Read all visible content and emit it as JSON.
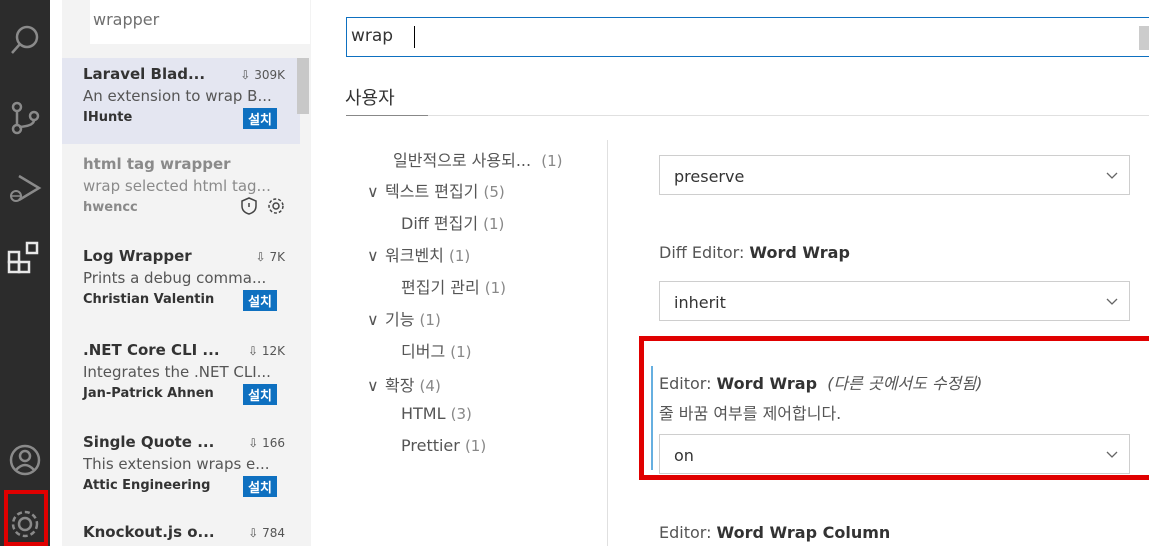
{
  "activity_bar": {
    "icons": [
      "search-icon",
      "source-control-icon",
      "run-debug-icon",
      "extensions-icon",
      "account-icon",
      "manage-gear-icon"
    ]
  },
  "extensions": {
    "search_value": "wrapper",
    "items": [
      {
        "name": "Laravel Blad...",
        "downloads": "309K",
        "description": "An extension to wrap B...",
        "publisher": "IHunte",
        "install_label": "설치"
      },
      {
        "name": "html tag wrapper",
        "downloads": "",
        "description": "wrap selected html tag...",
        "publisher": "hwencc",
        "install_label": ""
      },
      {
        "name": "Log Wrapper",
        "downloads": "7K",
        "description": "Prints a debug comma...",
        "publisher": "Christian Valentin",
        "install_label": "설치"
      },
      {
        "name": ".NET Core CLI ...",
        "downloads": "12K",
        "description": "Integrates the .NET CLI...",
        "publisher": "Jan-Patrick Ahnen",
        "install_label": "설치"
      },
      {
        "name": "Single Quote ...",
        "downloads": "166",
        "description": "This extension wraps e...",
        "publisher": "Attic Engineering",
        "install_label": "설치"
      },
      {
        "name": "Knockout.js o...",
        "downloads": "784",
        "description": "",
        "publisher": "",
        "install_label": ""
      }
    ]
  },
  "settings": {
    "search_value": "wrap",
    "tab_user": "사용자",
    "toc": [
      {
        "label": "일반적으로 사용되...",
        "count": "(1)"
      },
      {
        "label": "텍스트 편집기",
        "count": "(5)"
      },
      {
        "label": "Diff 편집기",
        "count": "(1)"
      },
      {
        "label": "워크벤치",
        "count": "(1)"
      },
      {
        "label": "편집기 관리",
        "count": "(1)"
      },
      {
        "label": "기능",
        "count": "(1)"
      },
      {
        "label": "디버그",
        "count": "(1)"
      },
      {
        "label": "확장",
        "count": "(4)"
      },
      {
        "label": "HTML",
        "count": "(3)"
      },
      {
        "label": "Prettier",
        "count": "(1)"
      }
    ],
    "items": {
      "first_dropdown_value": "preserve",
      "diff_title_prefix": "Diff Editor: ",
      "diff_title_bold": "Word Wrap",
      "diff_value": "inherit",
      "wrap_title_prefix": "Editor: ",
      "wrap_title_bold": "Word Wrap",
      "wrap_modified_note": "(다른 곳에서도 수정됨)",
      "wrap_description": "줄 바꿈 여부를 제어합니다.",
      "wrap_value": "on",
      "column_title_prefix": "Editor: ",
      "column_title_bold": "Word Wrap Column"
    }
  }
}
